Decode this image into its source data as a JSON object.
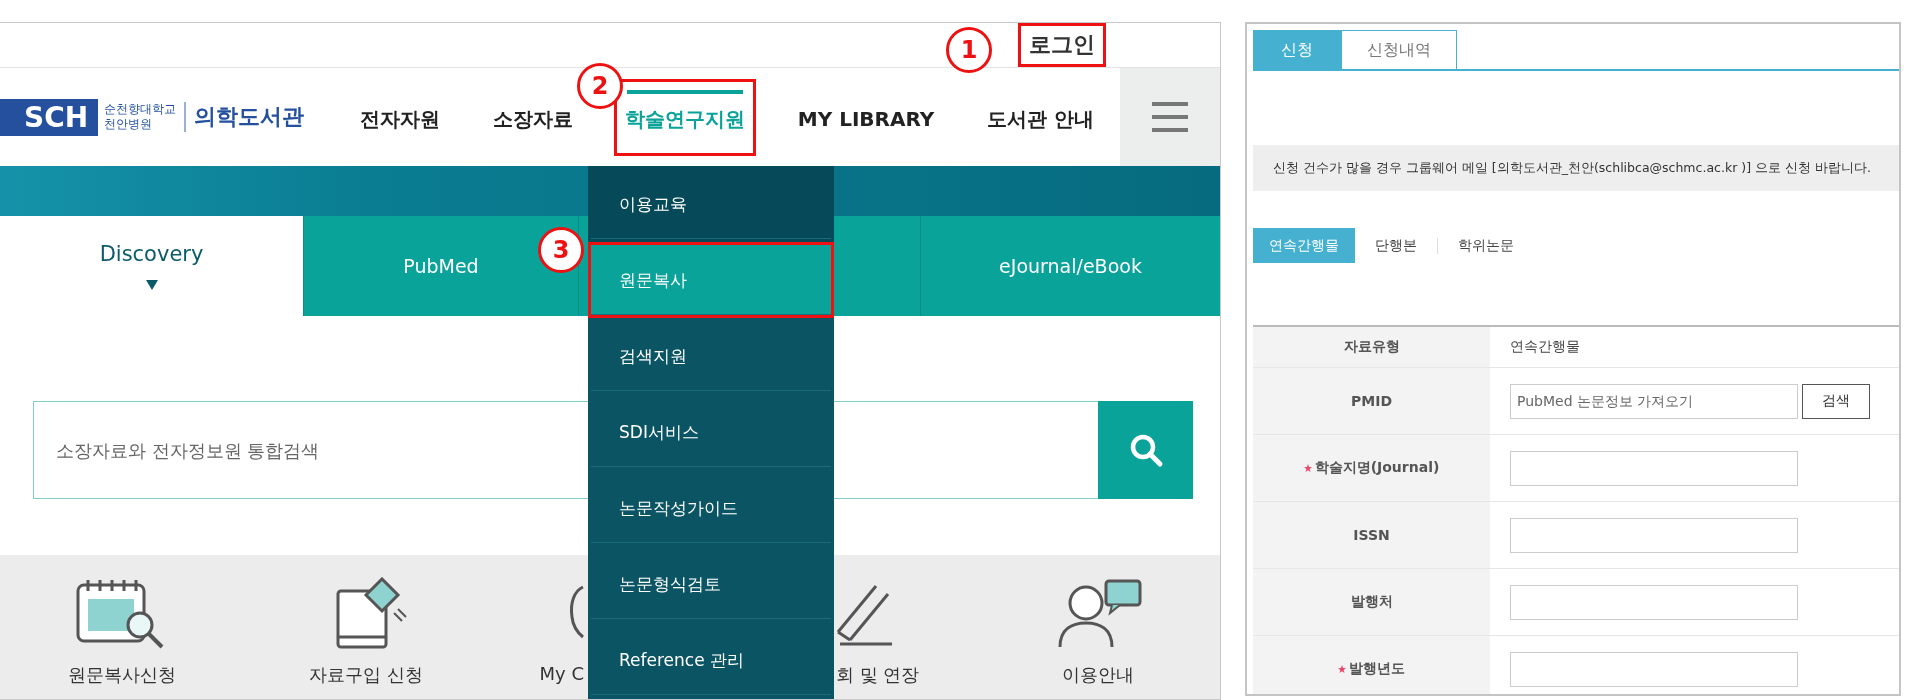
{
  "login_link": {
    "label": "로그인",
    "highlighted": true
  },
  "logo": {
    "mark": "SCH",
    "line_1": "순천향대학교",
    "line_2": "천안병원",
    "title": "의학도서관"
  },
  "nav": [
    {
      "label": "전자자원",
      "selected": false,
      "highlighted": false
    },
    {
      "label": "소장자료",
      "selected": false,
      "highlighted": false
    },
    {
      "label": "학술연구지원",
      "selected": true,
      "highlighted": true
    },
    {
      "label": "MY LIBRARY",
      "selected": false,
      "highlighted": false
    },
    {
      "label": "도서관 안내",
      "selected": false,
      "highlighted": false
    }
  ],
  "search_tabs": [
    {
      "label": "Discovery",
      "selected": true
    },
    {
      "label": "PubMed",
      "selected": false
    },
    {
      "selected": false
    },
    {
      "label": "eJournal/eBook",
      "selected": false
    }
  ],
  "search": {
    "placeholder": "소장자료와 전자정보원 통합검색"
  },
  "quick_links": [
    {
      "label": "원문복사신청",
      "kind": "full"
    },
    {
      "label": "자료구입 신청",
      "kind": "full"
    },
    {
      "label": "My C",
      "kind": "cut-end"
    },
    {
      "label": "회 및 연장",
      "kind": "cut-start"
    },
    {
      "label": "이용안내",
      "kind": "full"
    }
  ],
  "dropdown": [
    {
      "label": "이용교육",
      "selected": false,
      "highlighted": false
    },
    {
      "label": "원문복사",
      "selected": true,
      "highlighted": true
    },
    {
      "label": "검색지원",
      "selected": false,
      "highlighted": false
    },
    {
      "label": "SDI서비스",
      "selected": false,
      "highlighted": false
    },
    {
      "label": "논문작성가이드",
      "selected": false,
      "highlighted": false
    },
    {
      "label": "논문형식검토",
      "selected": false,
      "highlighted": false
    },
    {
      "label": "Reference 관리",
      "selected": false,
      "highlighted": false
    }
  ],
  "annotations": [
    {
      "label": "1"
    },
    {
      "label": "2"
    },
    {
      "label": "3"
    }
  ],
  "request_form": {
    "tabs": [
      {
        "label": "신청",
        "selected": true
      },
      {
        "label": "신청내역",
        "selected": false
      }
    ],
    "notice": "신청 건수가 많을 경우 그룹웨어 메일 [의학도서관_천안(schlibca@schmc.ac.kr )] 으로 신청 바랍니다.",
    "type_tabs": [
      {
        "label": "연속간행물",
        "selected": true
      },
      {
        "label": "단행본",
        "selected": false
      },
      {
        "label": "학위논문",
        "selected": false
      }
    ],
    "rows": [
      {
        "label": "자료유형",
        "required": false,
        "kind": "text",
        "value": "연속간행물"
      },
      {
        "label": "PMID",
        "required": false,
        "kind": "search",
        "placeholder": "PubMed 논문정보 가져오기",
        "button": "검색"
      },
      {
        "label": "학술지명(Journal)",
        "required": true,
        "kind": "input"
      },
      {
        "label": "ISSN",
        "required": false,
        "kind": "input"
      },
      {
        "label": "발행처",
        "required": false,
        "kind": "input"
      },
      {
        "label": "발행년도",
        "required": true,
        "kind": "input"
      }
    ]
  }
}
